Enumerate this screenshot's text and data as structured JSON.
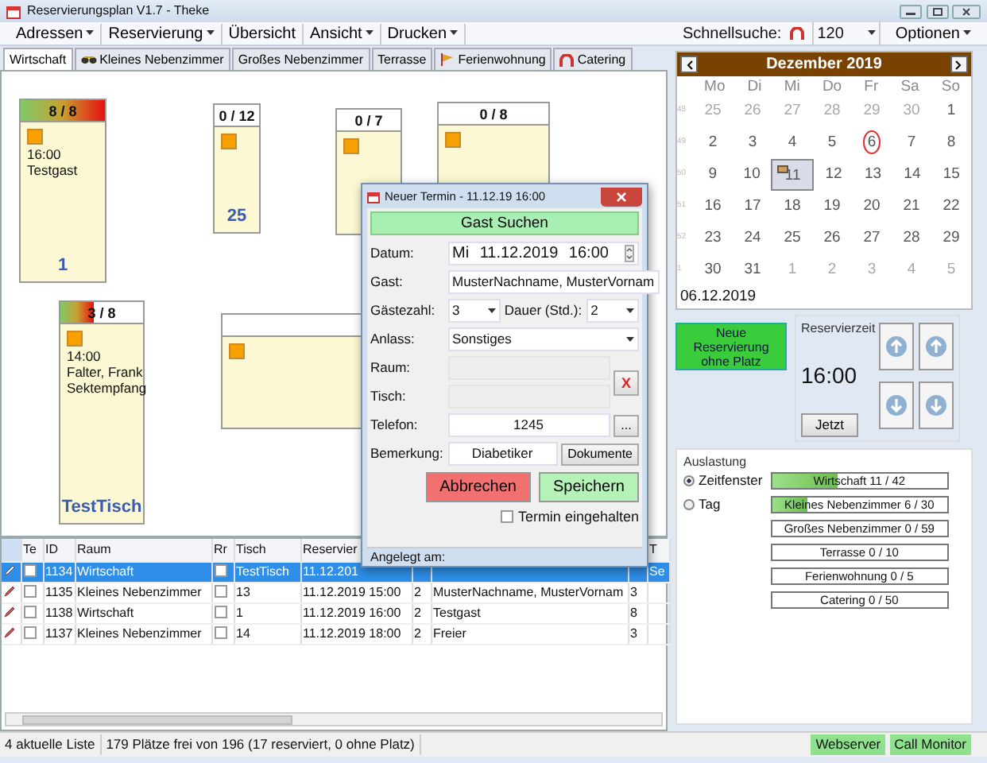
{
  "window": {
    "title": "Reservierungsplan V1.7 - Theke"
  },
  "menu": [
    {
      "label": "Adressen",
      "dropdown": true
    },
    {
      "label": "Reservierung",
      "dropdown": true
    },
    {
      "label": "Übersicht",
      "dropdown": false
    },
    {
      "label": "Ansicht",
      "dropdown": true
    },
    {
      "label": "Drucken",
      "dropdown": true
    }
  ],
  "quick_search": {
    "label": "Schnellsuche:",
    "value": "120",
    "options_menu": "Optionen"
  },
  "tabs": [
    {
      "label": "Wirtschaft",
      "selected": true
    },
    {
      "label": "Kleines Nebenzimmer",
      "selected": false
    },
    {
      "label": "Großes Nebenzimmer",
      "selected": false
    },
    {
      "label": "Terrasse",
      "selected": false
    },
    {
      "label": "Ferienwohnung",
      "selected": false
    },
    {
      "label": "Catering",
      "selected": false
    }
  ],
  "floor_tables": [
    {
      "count": "8 / 8",
      "level": 1,
      "entries": [
        "16:00",
        "Testgast"
      ],
      "name": "1"
    },
    {
      "count": "0 / 12",
      "level": 0,
      "name": "25"
    },
    {
      "count": "0 / 7",
      "level": 0
    },
    {
      "count": "0 / 8",
      "level": 0
    },
    {
      "count": "3 / 8",
      "level": 0.4,
      "entries": [
        "14:00",
        "Falter, Frank",
        "Sektempfang"
      ],
      "name": "TestTisch"
    },
    {
      "level": 0
    }
  ],
  "reservation_list": {
    "columns": [
      "Te",
      "ID",
      "Raum",
      "Rr",
      "Tisch",
      "Reservier",
      "T"
    ],
    "rows": [
      {
        "selected": true,
        "te": false,
        "id": "1134",
        "raum": "Wirtschaft",
        "rr": false,
        "tisch": "TestTisch",
        "reserviert": "11.12.201",
        "column_11": "Se"
      },
      {
        "selected": false,
        "te": false,
        "id": "1135",
        "raum": "Kleines Nebenzimmer",
        "rr": false,
        "tisch": "13",
        "reserviert": "11.12.2019 15:00",
        "column_8": "2",
        "column_9": "MusterNachname, MusterVornam",
        "column_10": "3"
      },
      {
        "selected": false,
        "te": false,
        "id": "1138",
        "raum": "Wirtschaft",
        "rr": false,
        "tisch": "1",
        "reserviert": "11.12.2019 16:00",
        "column_8": "2",
        "column_9": "Testgast",
        "column_10": "8"
      },
      {
        "selected": false,
        "te": false,
        "id": "1137",
        "raum": "Kleines Nebenzimmer",
        "rr": false,
        "tisch": "14",
        "reserviert": "11.12.2019 18:00",
        "column_8": "2",
        "column_9": "Freier",
        "column_10": "3"
      }
    ]
  },
  "dialog": {
    "title": "Neuer Termin - 11.12.19 16:00",
    "search_button": "Gast Suchen",
    "datum": {
      "label": "Datum:",
      "value": "Mi 11.12.2019 16:00"
    },
    "gast": {
      "label": "Gast:",
      "value": "MusterNachname, MusterVornam"
    },
    "gaestezahl": {
      "label": "Gästezahl:",
      "value": "3"
    },
    "dauer": {
      "label": "Dauer (Std.):",
      "value": "2"
    },
    "anlass": {
      "label": "Anlass:",
      "value": "Sonstiges"
    },
    "raum": {
      "label": "Raum:"
    },
    "tisch": {
      "label": "Tisch:"
    },
    "clear_button": "X",
    "telefon": {
      "label": "Telefon:",
      "value": "1245",
      "more_button": "..."
    },
    "bemerkung": {
      "label": "Bemerkung:",
      "value": "Diabetiker",
      "button": "Dokumente"
    },
    "cancel_button": "Abbrechen",
    "save_button": "Speichern",
    "kept": {
      "label": "Termin eingehalten",
      "checked": false
    },
    "footer": "Angelegt am:"
  },
  "calendar": {
    "month": "Dezember 2019",
    "weekdays": [
      "Mo",
      "Di",
      "Mi",
      "Do",
      "Fr",
      "Sa",
      "So"
    ],
    "weeks": [
      {
        "week": "48",
        "days": [
          {
            "d": "25",
            "muted": true,
            "selected": false,
            "today": false,
            "entry": false
          },
          {
            "d": "26",
            "muted": true,
            "selected": false,
            "today": false,
            "entry": false
          },
          {
            "d": "27",
            "muted": true,
            "selected": false,
            "today": false,
            "entry": false
          },
          {
            "d": "28",
            "muted": true,
            "selected": false,
            "today": false,
            "entry": false
          },
          {
            "d": "29",
            "muted": true,
            "selected": false,
            "today": false,
            "entry": false
          },
          {
            "d": "30",
            "muted": true,
            "selected": false,
            "today": false,
            "entry": false
          },
          {
            "d": "1",
            "muted": false,
            "selected": false,
            "today": false,
            "entry": false
          }
        ]
      },
      {
        "week": "49",
        "days": [
          {
            "d": "2",
            "muted": false,
            "selected": false,
            "today": false,
            "entry": false
          },
          {
            "d": "3",
            "muted": false,
            "selected": false,
            "today": false,
            "entry": false
          },
          {
            "d": "4",
            "muted": false,
            "selected": false,
            "today": false,
            "entry": false
          },
          {
            "d": "5",
            "muted": false,
            "selected": false,
            "today": false,
            "entry": false
          },
          {
            "d": "6",
            "muted": false,
            "selected": false,
            "today": true,
            "entry": false
          },
          {
            "d": "7",
            "muted": false,
            "selected": false,
            "today": false,
            "entry": false
          },
          {
            "d": "8",
            "muted": false,
            "selected": false,
            "today": false,
            "entry": false
          }
        ]
      },
      {
        "week": "50",
        "days": [
          {
            "d": "9",
            "muted": false,
            "selected": false,
            "today": false,
            "entry": false
          },
          {
            "d": "10",
            "muted": false,
            "selected": false,
            "today": false,
            "entry": false
          },
          {
            "d": "11",
            "muted": false,
            "selected": true,
            "today": false,
            "entry": true
          },
          {
            "d": "12",
            "muted": false,
            "selected": false,
            "today": false,
            "entry": false
          },
          {
            "d": "13",
            "muted": false,
            "selected": false,
            "today": false,
            "entry": false
          },
          {
            "d": "14",
            "muted": false,
            "selected": false,
            "today": false,
            "entry": false
          },
          {
            "d": "15",
            "muted": false,
            "selected": false,
            "today": false,
            "entry": false
          }
        ]
      },
      {
        "week": "51",
        "days": [
          {
            "d": "16",
            "muted": false,
            "selected": false,
            "today": false,
            "entry": false
          },
          {
            "d": "17",
            "muted": false,
            "selected": false,
            "today": false,
            "entry": false
          },
          {
            "d": "18",
            "muted": false,
            "selected": false,
            "today": false,
            "entry": false
          },
          {
            "d": "19",
            "muted": false,
            "selected": false,
            "today": false,
            "entry": false
          },
          {
            "d": "20",
            "muted": false,
            "selected": false,
            "today": false,
            "entry": false
          },
          {
            "d": "21",
            "muted": false,
            "selected": false,
            "today": false,
            "entry": false
          },
          {
            "d": "22",
            "muted": false,
            "selected": false,
            "today": false,
            "entry": false
          }
        ]
      },
      {
        "week": "52",
        "days": [
          {
            "d": "23",
            "muted": false,
            "selected": false,
            "today": false,
            "entry": false
          },
          {
            "d": "24",
            "muted": false,
            "selected": false,
            "today": false,
            "entry": false
          },
          {
            "d": "25",
            "muted": false,
            "selected": false,
            "today": false,
            "entry": false
          },
          {
            "d": "26",
            "muted": false,
            "selected": false,
            "today": false,
            "entry": false
          },
          {
            "d": "27",
            "muted": false,
            "selected": false,
            "today": false,
            "entry": false
          },
          {
            "d": "28",
            "muted": false,
            "selected": false,
            "today": false,
            "entry": false
          },
          {
            "d": "29",
            "muted": false,
            "selected": false,
            "today": false,
            "entry": false
          }
        ]
      },
      {
        "week": "1",
        "days": [
          {
            "d": "30",
            "muted": false,
            "selected": false,
            "today": false,
            "entry": false
          },
          {
            "d": "31",
            "muted": false,
            "selected": false,
            "today": false,
            "entry": false
          },
          {
            "d": "1",
            "muted": true,
            "selected": false,
            "today": false,
            "entry": false
          },
          {
            "d": "2",
            "muted": true,
            "selected": false,
            "today": false,
            "entry": false
          },
          {
            "d": "3",
            "muted": true,
            "selected": false,
            "today": false,
            "entry": false
          },
          {
            "d": "4",
            "muted": true,
            "selected": false,
            "today": false,
            "entry": false
          },
          {
            "d": "5",
            "muted": true,
            "selected": false,
            "today": false,
            "entry": false
          }
        ]
      }
    ],
    "selected_date": "06.12.2019"
  },
  "new_reservation_button": "Neue Reservierung ohne Platz",
  "reservation_time": {
    "label": "Reservierzeit",
    "time": "16:00",
    "now_button": "Jetzt"
  },
  "occupancy": {
    "label": "Auslastung",
    "modes": [
      {
        "label": "Zeitfenster",
        "selected": true
      },
      {
        "label": "Tag",
        "selected": false
      }
    ],
    "bars": [
      {
        "label": "Wirtschaft 11 / 42",
        "level": 0.38
      },
      {
        "label": "Kleines Nebenzimmer 6 / 30",
        "level": 0.2
      },
      {
        "label": "Großes Nebenzimmer 0 / 59",
        "level": 0
      },
      {
        "label": "Terrasse 0 / 10",
        "level": 0
      },
      {
        "label": "Ferienwohnung 0 / 5",
        "level": 0
      },
      {
        "label": "Catering 0 / 50",
        "level": 0
      }
    ]
  },
  "status_bar": {
    "left": [
      "4 aktuelle Liste",
      "179 Plätze frei von 196 (17 reserviert, 0 ohne Platz)"
    ],
    "right": [
      "Webserver",
      "Call Monitor"
    ]
  }
}
